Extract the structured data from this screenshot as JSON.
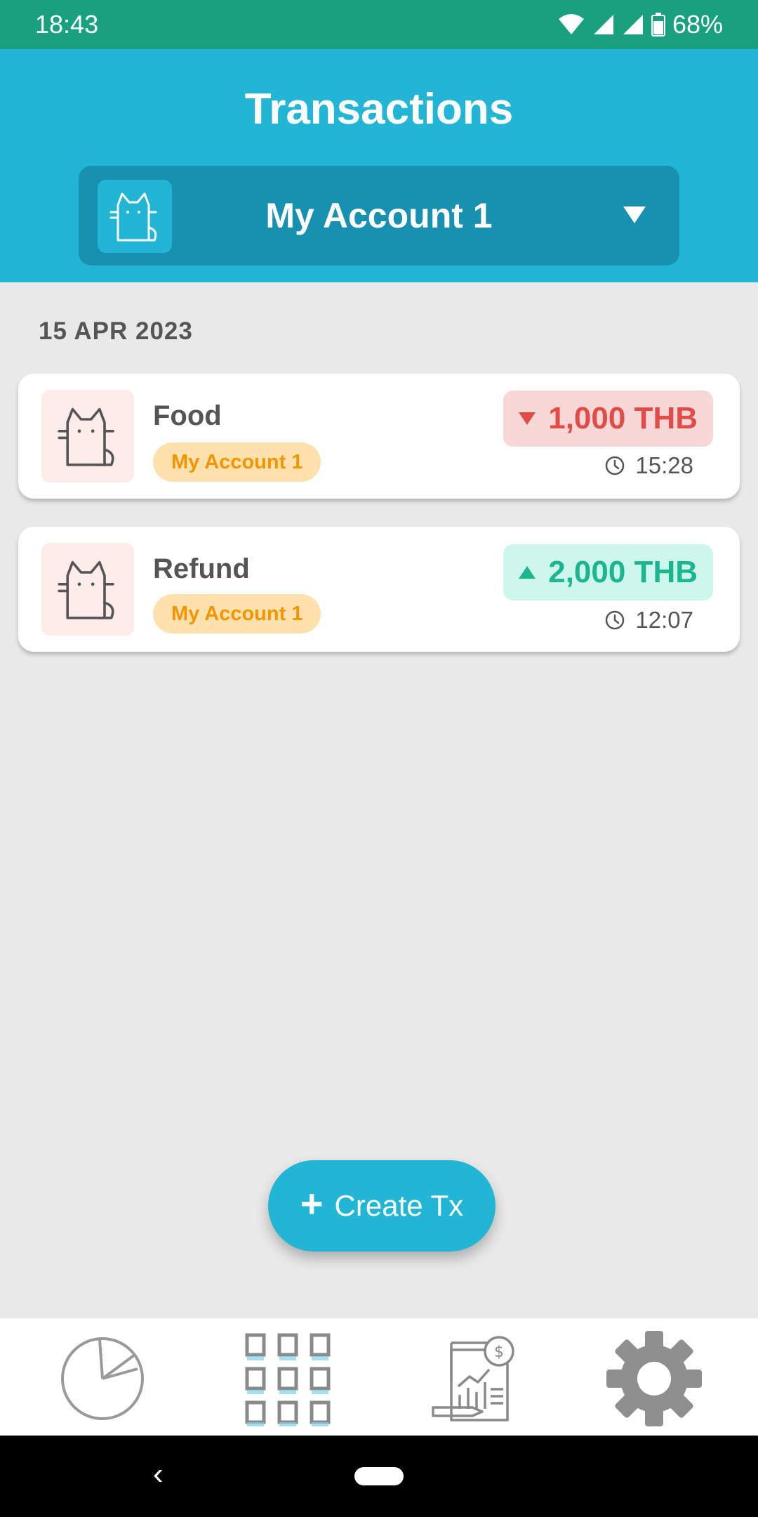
{
  "status_bar": {
    "time": "18:43",
    "battery": "68%",
    "icons": [
      "wifi-icon",
      "signal-icon",
      "signal-icon",
      "battery-icon"
    ]
  },
  "header": {
    "title": "Transactions",
    "account_selector": {
      "name": "My Account 1",
      "avatar_icon": "cat-icon",
      "dropdown_icon": "chevron-down-icon"
    }
  },
  "transactions": {
    "date_header": "15 APR 2023",
    "items": [
      {
        "title": "Food",
        "account": "My Account 1",
        "amount": "1,000 THB",
        "type": "expense",
        "time": "15:28",
        "icon": "cat-icon"
      },
      {
        "title": "Refund",
        "account": "My Account 1",
        "amount": "2,000 THB",
        "type": "income",
        "time": "12:07",
        "icon": "cat-icon"
      }
    ]
  },
  "fab": {
    "label": "Create Tx",
    "icon": "plus-icon"
  },
  "bottom_nav": {
    "items": [
      {
        "icon": "pie-chart-icon",
        "active": false
      },
      {
        "icon": "grid-icon",
        "active": true
      },
      {
        "icon": "report-icon",
        "active": false
      },
      {
        "icon": "gear-icon",
        "active": false
      }
    ]
  },
  "colors": {
    "status_bar": "#19a07f",
    "header": "#22b5d6",
    "selector": "#1891b0",
    "expense": "#e24c48",
    "income": "#1bb58e",
    "badge_bg": "#ffe1ae",
    "badge_text": "#f29500"
  }
}
